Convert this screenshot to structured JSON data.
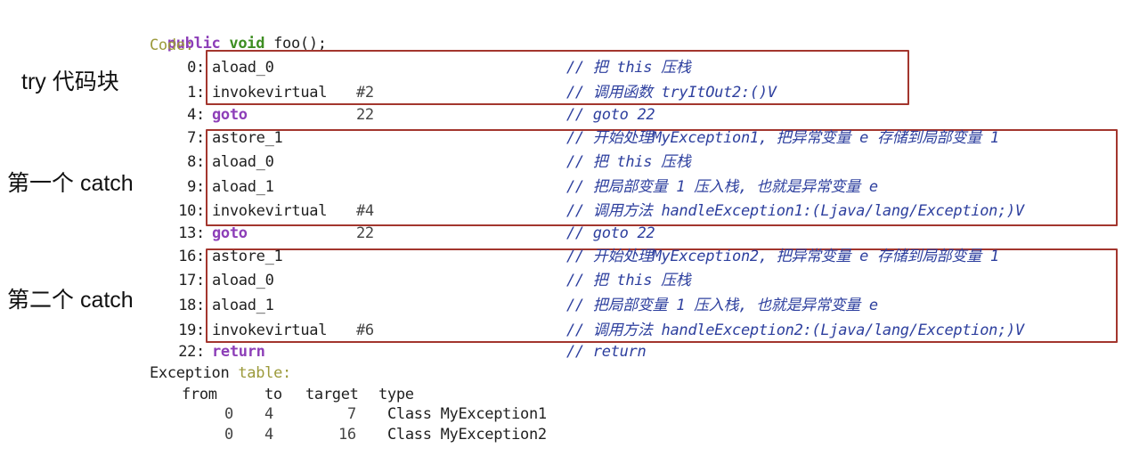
{
  "signature": {
    "modifier": "public",
    "ret": "void",
    "name": "foo();"
  },
  "code_label": "Code:",
  "labels": {
    "try_block": "try 代码块",
    "catch1": "第一个 catch",
    "catch2": "第二个 catch"
  },
  "instructions": [
    {
      "offset": "0:",
      "op": "aload_0",
      "operand": "",
      "comment": "// 把 this 压栈"
    },
    {
      "offset": "1:",
      "op": "invokevirtual",
      "operand": "#2",
      "comment": "// 调用函数 tryItOut2:()V"
    },
    {
      "offset": "4:",
      "op": "goto",
      "operand": "22",
      "comment": "// goto 22"
    },
    {
      "offset": "7:",
      "op": "astore_1",
      "operand": "",
      "comment": "// 开始处理MyException1, 把异常变量 e 存储到局部变量 1"
    },
    {
      "offset": "8:",
      "op": "aload_0",
      "operand": "",
      "comment": "// 把 this 压栈"
    },
    {
      "offset": "9:",
      "op": "aload_1",
      "operand": "",
      "comment": "// 把局部变量 1 压入栈, 也就是异常变量 e"
    },
    {
      "offset": "10:",
      "op": "invokevirtual",
      "operand": "#4",
      "comment": "// 调用方法 handleException1:(Ljava/lang/Exception;)V"
    },
    {
      "offset": "13:",
      "op": "goto",
      "operand": "22",
      "comment": "// goto 22"
    },
    {
      "offset": "16:",
      "op": "astore_1",
      "operand": "",
      "comment": "// 开始处理MyException2, 把异常变量 e 存储到局部变量 1"
    },
    {
      "offset": "17:",
      "op": "aload_0",
      "operand": "",
      "comment": "// 把 this 压栈"
    },
    {
      "offset": "18:",
      "op": "aload_1",
      "operand": "",
      "comment": "// 把局部变量 1 压入栈, 也就是异常变量 e"
    },
    {
      "offset": "19:",
      "op": "invokevirtual",
      "operand": "#6",
      "comment": "// 调用方法 handleException2:(Ljava/lang/Exception;)V"
    },
    {
      "offset": "22:",
      "op": "return",
      "operand": "",
      "comment": "// return"
    }
  ],
  "exception_table": {
    "title_a": "Exception",
    "title_b": "table:",
    "headers": {
      "from": "from",
      "to": "to",
      "target": "target",
      "type": "type"
    },
    "rows": [
      {
        "from": "0",
        "to": "4",
        "target": "7",
        "type": "Class MyException1"
      },
      {
        "from": "0",
        "to": "4",
        "target": "16",
        "type": "Class MyException2"
      }
    ]
  }
}
